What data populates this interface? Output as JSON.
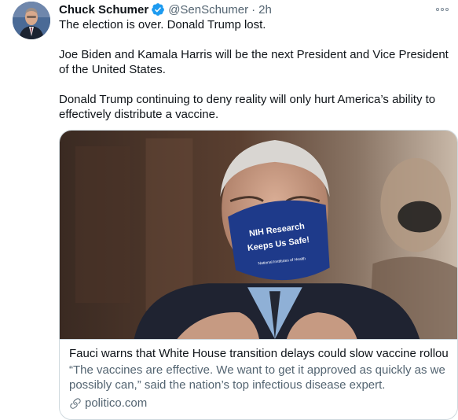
{
  "author": {
    "name": "Chuck Schumer",
    "handle": "@SenSchumer",
    "separator": "·",
    "time": "2h",
    "verified": true
  },
  "tweet": {
    "paragraphs": [
      "The election is over. Donald Trump lost.",
      "Joe Biden and Kamala Harris will be the next President and Vice President of the United States.",
      "Donald Trump continuing to deny reality will only hurt America’s ability to effectively distribute a vaccine."
    ]
  },
  "card": {
    "image_mask_text_line1": "NIH Research",
    "image_mask_text_line2": "Keeps Us Safe!",
    "image_mask_text_line3": "National Institutes of Health",
    "title": "Fauci warns that White House transition delays could slow vaccine rollout",
    "description": "“The vaccines are effective. We want to get it approved as quickly as we possibly can,” said the nation’s top infectious disease expert.",
    "domain": "politico.com",
    "domain_icon": "link-icon"
  },
  "colors": {
    "text": "#0f1419",
    "secondary": "#536471",
    "verified": "#1d9bf0",
    "border": "#cfd9de"
  },
  "icons": {
    "verified": "verified-badge-icon",
    "more": "more-options-icon"
  }
}
